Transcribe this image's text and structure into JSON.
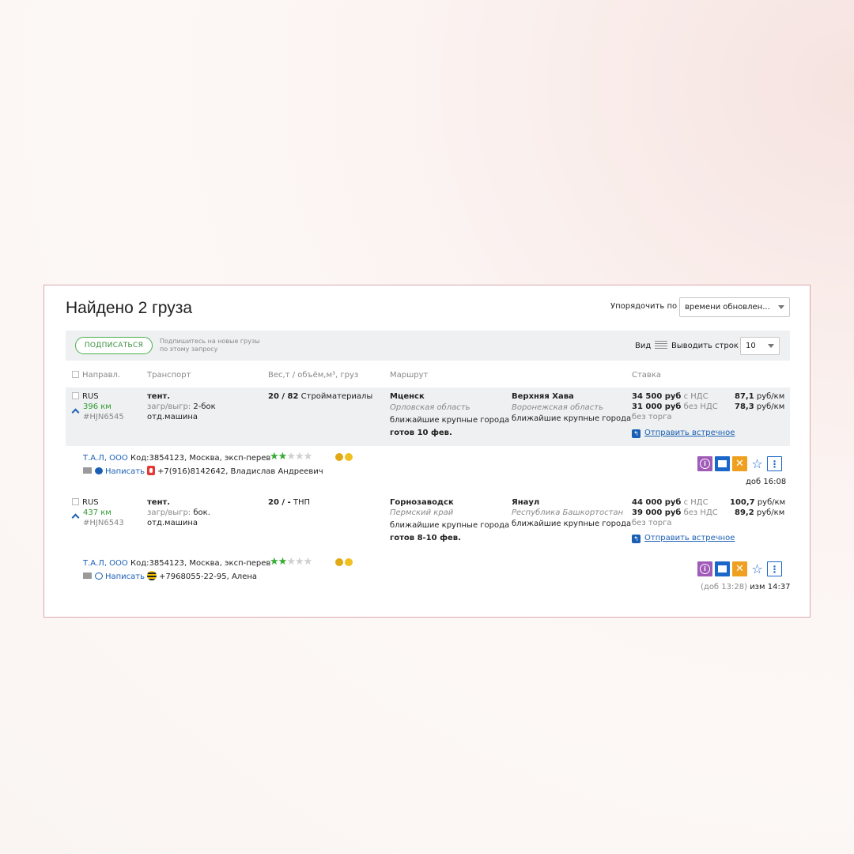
{
  "header": {
    "title": "Найдено 2 груза",
    "sort_label": "Упорядочить по",
    "sort_value": "времени обновлен..."
  },
  "toolbar": {
    "subscribe_label": "ПОДПИСАТЬСЯ",
    "subscribe_hint": "Подпишитесь на новые грузы по этому запросу",
    "view_label": "Вид",
    "rows_label": "Выводить строк",
    "rows_value": "10"
  },
  "columns": {
    "direction": "Направл.",
    "transport": "Транспорт",
    "cargo": "Вес,т / объём,м³, груз",
    "route": "Маршрут",
    "rate": "Ставка"
  },
  "cargos": [
    {
      "country": "RUS",
      "distance": "396 км",
      "id": "#HJN6545",
      "transport_type": "тент.",
      "load_label": "загр/выгр:",
      "load_value": "2-бок",
      "vehicle": "отд.машина",
      "weight_volume": "20 / 82",
      "cargo_name": "Стройматериалы",
      "from_city": "Мценск",
      "from_region": "Орловская область",
      "from_nearby": "ближайшие крупные города",
      "ready": "готов 10 фев.",
      "to_city": "Верхняя Хава",
      "to_region": "Воронежская область",
      "to_nearby": "ближайшие крупные города",
      "rate_vat": "34 500 руб",
      "rate_vat_suffix": "с НДС",
      "rate_novat": "31 000 руб",
      "rate_novat_suffix": "без НДС",
      "no_bargain": "без торга",
      "per_km_vat_value": "87,1",
      "per_km_vat_unit": "руб/км",
      "per_km_novat_value": "78,3",
      "per_km_novat_unit": "руб/км",
      "counter_offer": "Отправить встречное",
      "company": "Т.А.Л, ООО",
      "company_info": "Код:3854123, Москва, эксп-перев",
      "rating": 1.5,
      "write_label": "Написать",
      "contact": "+7(916)8142642, Владислав Андреевич",
      "added_label": "доб 16:08",
      "added_paren": "",
      "changed_label": ""
    },
    {
      "country": "RUS",
      "distance": "437 км",
      "id": "#HJN6543",
      "transport_type": "тент.",
      "load_label": "загр/выгр:",
      "load_value": "бок.",
      "vehicle": "отд.машина",
      "weight_volume": "20 / -",
      "cargo_name": "ТНП",
      "from_city": "Горнозаводск",
      "from_region": "Пермский край",
      "from_nearby": "ближайшие крупные города",
      "ready": "готов 8-10 фев.",
      "to_city": "Янаул",
      "to_region": "Республика Башкортостан",
      "to_nearby": "ближайшие крупные города",
      "rate_vat": "44 000 руб",
      "rate_vat_suffix": "с НДС",
      "rate_novat": "39 000 руб",
      "rate_novat_suffix": "без НДС",
      "no_bargain": "без торга",
      "per_km_vat_value": "100,7",
      "per_km_vat_unit": "руб/км",
      "per_km_novat_value": "89,2",
      "per_km_novat_unit": "руб/км",
      "counter_offer": "Отправить встречное",
      "company": "Т.А.Л, ООО",
      "company_info": "Код:3854123, Москва, эксп-перев",
      "rating": 1.5,
      "write_label": "Написать",
      "contact": "+7968055-22-95, Алена",
      "added_label": "",
      "added_paren": "(доб 13:28)",
      "changed_label": "изм 14:37"
    }
  ],
  "colors": {
    "accent_blue": "#1a5fb4",
    "subscribe_green": "#4caf50",
    "distance_green": "#2e9c2e",
    "row_background": "#eef0f1",
    "panel_border": "#dba8ae"
  },
  "icons": {
    "info": "info-icon",
    "message": "message-icon",
    "hide": "close-icon",
    "favorite": "star-icon",
    "more": "more-vertical-icon",
    "reply": "reply-icon",
    "mail": "mail-icon",
    "chat": "chat-icon"
  }
}
